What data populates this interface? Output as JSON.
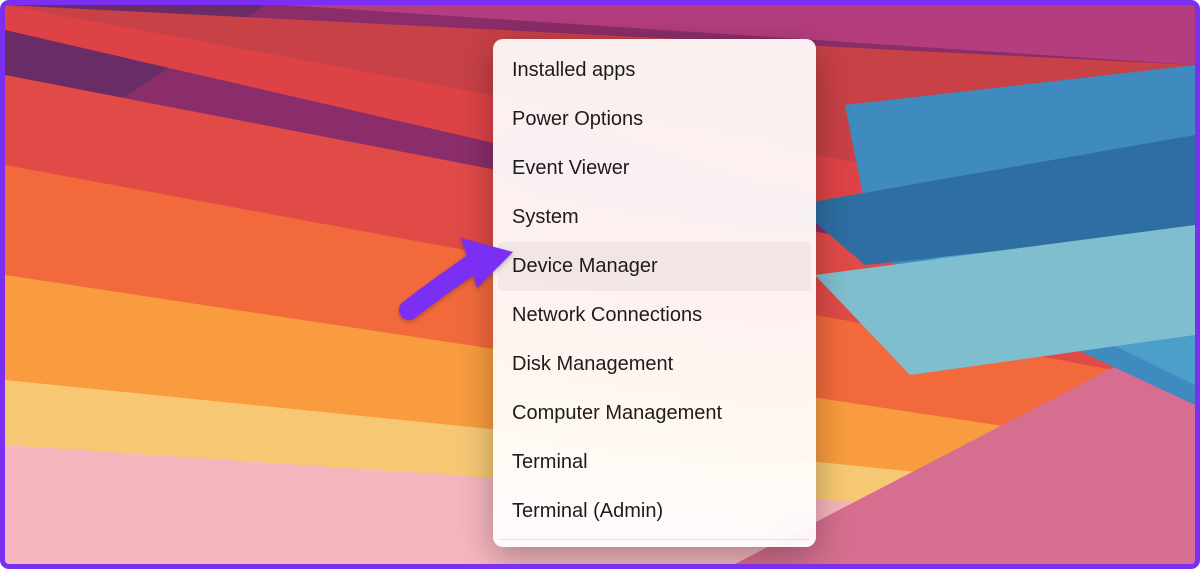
{
  "menu": {
    "items": [
      {
        "id": "installed-apps",
        "label": "Installed apps"
      },
      {
        "id": "power-options",
        "label": "Power Options"
      },
      {
        "id": "event-viewer",
        "label": "Event Viewer"
      },
      {
        "id": "system",
        "label": "System"
      },
      {
        "id": "device-manager",
        "label": "Device Manager"
      },
      {
        "id": "network-connections",
        "label": "Network Connections"
      },
      {
        "id": "disk-management",
        "label": "Disk Management"
      },
      {
        "id": "computer-management",
        "label": "Computer Management"
      },
      {
        "id": "terminal",
        "label": "Terminal"
      },
      {
        "id": "terminal-admin",
        "label": "Terminal (Admin)"
      }
    ],
    "hovered_index": 4
  },
  "annotation": {
    "arrow_color": "#7b2ff2",
    "points_to": "device-manager"
  },
  "frame": {
    "border_color": "#7b2ff2"
  }
}
